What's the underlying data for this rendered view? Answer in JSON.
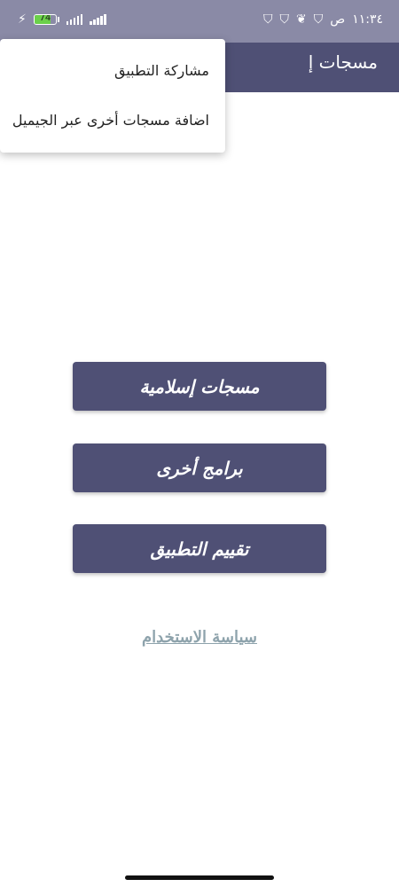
{
  "status_bar": {
    "time": "١١:٣٤",
    "am_pm": "ص",
    "battery_level": "74",
    "battery_fraction": 0.74,
    "icons": [
      "shield-icon",
      "fish-icon",
      "shield-icon",
      "shield-icon",
      "signal-icon",
      "signal-icon",
      "charging-icon"
    ]
  },
  "app_bar": {
    "title": "مسجات إ"
  },
  "menu": {
    "items": [
      {
        "label": "مشاركة التطبيق"
      },
      {
        "label": "اضافة مسجات أخرى عبر الجيميل"
      }
    ]
  },
  "buttons": {
    "islamic_messages": "مسجات إسلامية",
    "other_apps": "برامج أخرى",
    "rate_app": "تقييم التطبيق"
  },
  "links": {
    "privacy_policy": "سياسة الاستخدام"
  },
  "colors": {
    "primary": "#4f5075",
    "status_bar": "#8a8aa6",
    "link": "#8ea3ac",
    "battery": "#6bd04a"
  }
}
